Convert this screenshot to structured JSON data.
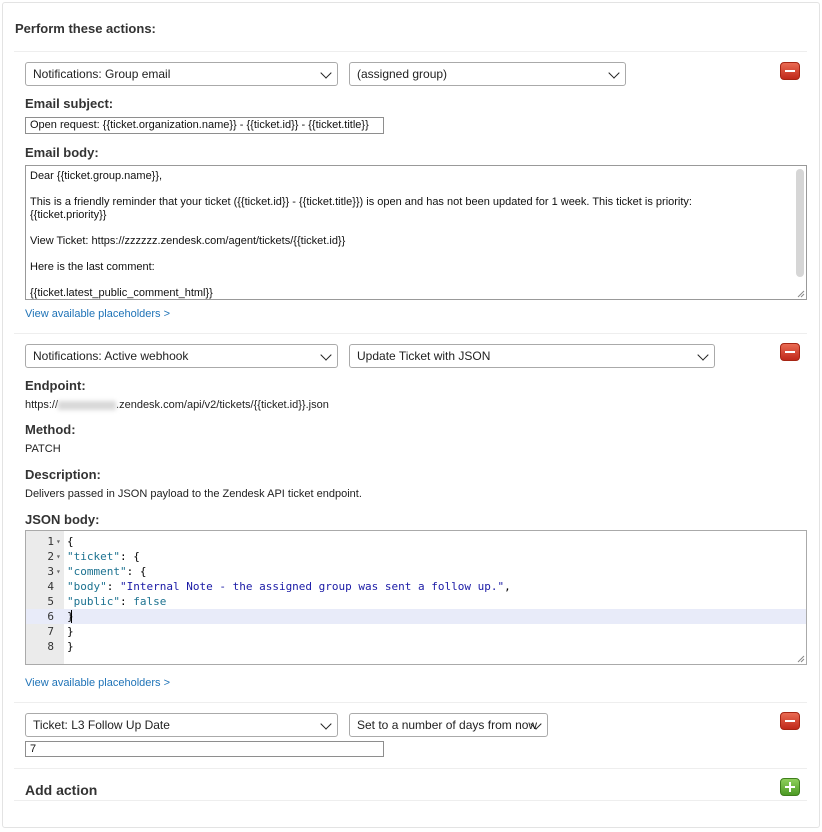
{
  "section_title": "Perform these actions:",
  "actions": [
    {
      "field_select": "Notifications: Group email",
      "target_select": "(assigned group)",
      "subject_label": "Email subject:",
      "subject_value": "Open request: {{ticket.organization.name}} - {{ticket.id}} - {{ticket.title}}",
      "body_label": "Email body:",
      "body_lines": [
        "Dear {{ticket.group.name}},",
        "",
        "This is a friendly reminder that your ticket ({{ticket.id}} - {{ticket.title}}) is open and has not been updated for 1 week.  This ticket is priority:",
        "{{ticket.priority}}",
        "",
        "View Ticket: https://zzzzzz.zendesk.com/agent/tickets/{{ticket.id}}",
        "",
        "Here is the last comment:",
        "",
        "{{ticket.latest_public_comment_html}}"
      ],
      "placeholders_link": "View available placeholders >"
    },
    {
      "field_select": "Notifications: Active webhook",
      "target_select": "Update Ticket with JSON",
      "endpoint_label": "Endpoint:",
      "endpoint_prefix": "https://",
      "endpoint_suffix": ".zendesk.com/api/v2/tickets/{{ticket.id}}.json",
      "method_label": "Method:",
      "method_value": "PATCH",
      "description_label": "Description:",
      "description_value": "Delivers passed in JSON payload to the Zendesk API ticket endpoint.",
      "json_label": "JSON body:",
      "code_lines": [
        {
          "num": "1",
          "fold": true,
          "tokens": [
            {
              "t": "{",
              "c": "p"
            }
          ]
        },
        {
          "num": "2",
          "fold": true,
          "tokens": [
            {
              "t": "\"ticket\"",
              "c": "k"
            },
            {
              "t": ": {",
              "c": "p"
            }
          ]
        },
        {
          "num": "3",
          "fold": true,
          "tokens": [
            {
              "t": "\"comment\"",
              "c": "k"
            },
            {
              "t": ": {",
              "c": "p"
            }
          ]
        },
        {
          "num": "4",
          "fold": false,
          "tokens": [
            {
              "t": "\"body\"",
              "c": "k"
            },
            {
              "t": ": ",
              "c": "p"
            },
            {
              "t": "\"Internal Note - the assigned group was sent a follow up.\"",
              "c": "s"
            },
            {
              "t": ",",
              "c": "p"
            }
          ]
        },
        {
          "num": "5",
          "fold": false,
          "tokens": [
            {
              "t": "\"public\"",
              "c": "k"
            },
            {
              "t": ": ",
              "c": "p"
            },
            {
              "t": "false",
              "c": "b"
            }
          ]
        },
        {
          "num": "6",
          "fold": false,
          "active": true,
          "tokens": [
            {
              "t": "}",
              "c": "p"
            }
          ]
        },
        {
          "num": "7",
          "fold": false,
          "tokens": [
            {
              "t": "}",
              "c": "p"
            }
          ]
        },
        {
          "num": "8",
          "fold": false,
          "tokens": [
            {
              "t": "}",
              "c": "p"
            }
          ]
        }
      ],
      "placeholders_link": "View available placeholders >"
    },
    {
      "field_select": "Ticket: L3 Follow Up Date",
      "target_select": "Set to a number of days from now",
      "value": "7"
    }
  ],
  "add_action_label": "Add action",
  "colors": {
    "link": "#1f73b7",
    "remove_button": "#d0402c",
    "add_button": "#6cb43f",
    "json_key": "#1c7290",
    "json_string": "#1a1aa6"
  }
}
